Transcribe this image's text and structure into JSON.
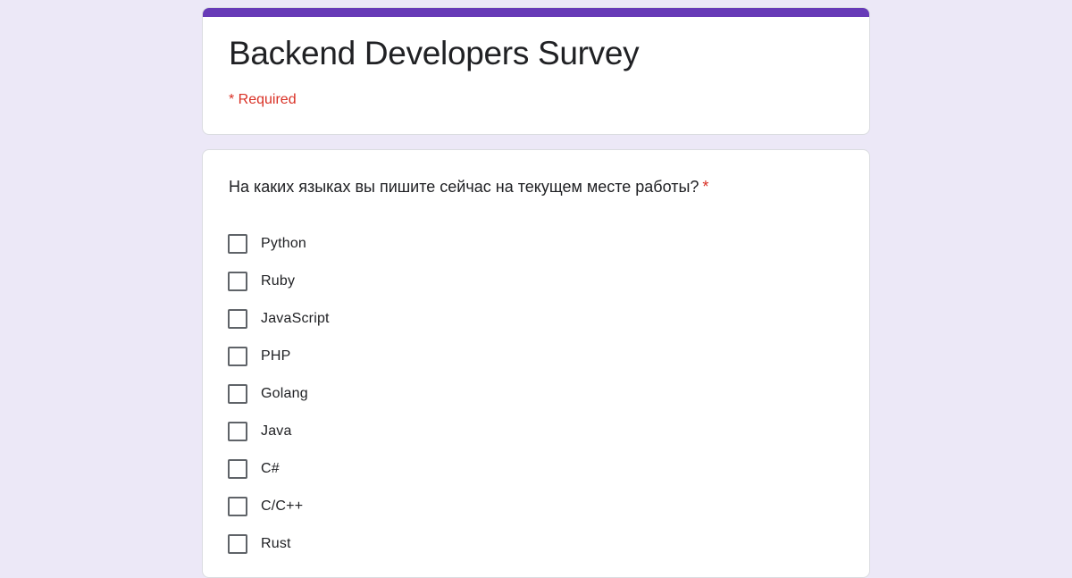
{
  "form": {
    "title": "Backend Developers Survey",
    "required_note": "* Required"
  },
  "question": {
    "text": "На каких языках вы пишите сейчас на текущем месте работы?",
    "required_mark": "*",
    "options": [
      {
        "label": "Python",
        "checked": false
      },
      {
        "label": "Ruby",
        "checked": false
      },
      {
        "label": "JavaScript",
        "checked": false
      },
      {
        "label": "PHP",
        "checked": false
      },
      {
        "label": "Golang",
        "checked": false
      },
      {
        "label": "Java",
        "checked": false
      },
      {
        "label": "C#",
        "checked": false
      },
      {
        "label": "C/C++",
        "checked": false
      },
      {
        "label": "Rust",
        "checked": false
      }
    ]
  },
  "colors": {
    "background": "#ece8f7",
    "accent": "#673ab7",
    "required": "#d93025",
    "text": "#202124",
    "checkbox_border": "#5f6368"
  }
}
